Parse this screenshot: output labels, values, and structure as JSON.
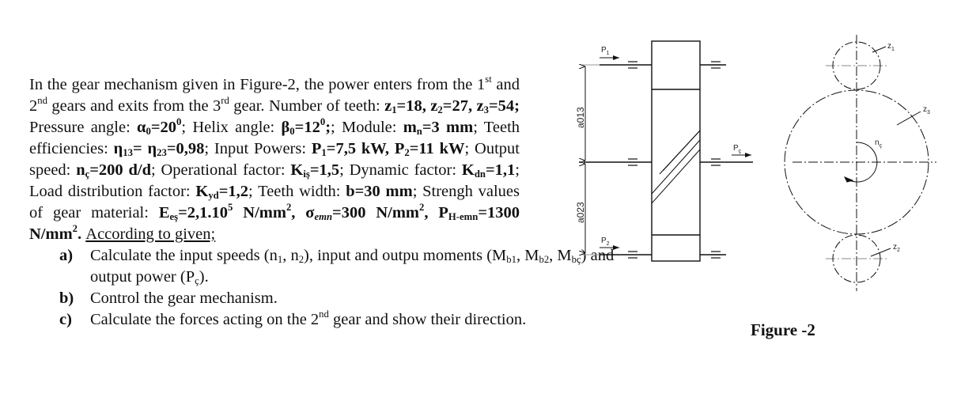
{
  "problem": {
    "intro_1": "In the gear mechanism given in Figure-2, the power enters from the 1",
    "sup_st": "st",
    "intro_2": " and 2",
    "sup_nd": "nd",
    "intro_3": " gears and exits from the 3",
    "sup_rd": "rd",
    "intro_4": " gear. Number of teeth: ",
    "teeth": [
      {
        "sym": "z",
        "sub": "1",
        "val": "=18, "
      },
      {
        "sym": "z",
        "sub": "2",
        "val": "=27, "
      },
      {
        "sym": "z",
        "sub": "3",
        "val": "=54;"
      }
    ],
    "pressure_label": " Pressure angle: ",
    "pressure_sym": "α",
    "pressure_sub": "0",
    "pressure_val": "=20",
    "pressure_unit_sup": "0",
    "helix_label": "; Helix angle: ",
    "helix_sym": "β",
    "helix_sub": "0",
    "helix_val": "=12",
    "helix_unit_sup": "0",
    "module_label": "; Module: ",
    "module_sym": "m",
    "module_sub": "n",
    "module_val": "=3 mm",
    "eff_label": "; Teeth efficiencies: ",
    "eff_sym1": "η",
    "eff_sub1": "13",
    "eff_mid": "= ",
    "eff_sym2": "η",
    "eff_sub2": "23",
    "eff_val": "=0,98",
    "power_label": "; Input Powers: ",
    "p1_sym": "P",
    "p1_sub": "1",
    "p1_val": "=7,5 kW, ",
    "p2_sym": "P",
    "p2_sub": "2",
    "p2_val": "=11 kW",
    "speed_label": "; Output speed: ",
    "speed_sym": "n",
    "speed_sub": "ç",
    "speed_val": "=200 d/d",
    "op_label": "; Operational factor: ",
    "op_sym": "K",
    "op_sub": "iş",
    "op_val": "=1,5",
    "dyn_label": "; Dynamic factor: ",
    "dyn_sym": "K",
    "dyn_sub": "dn",
    "dyn_val": "=1,1",
    "load_label": "; Load distribution factor: ",
    "load_sym": "K",
    "load_sub": "yd",
    "load_val": "=1,2",
    "width_label": "; Teeth width: ",
    "width_val": "b=30 mm",
    "strength_label": "; Strengh values of gear material: ",
    "e_sym": "E",
    "e_sub": "eş",
    "e_val": "=2,1.10",
    "e_exp": "5",
    "e_unit": " N/mm",
    "e_unit_sup": "2",
    "sigma_sym": "σ",
    "sigma_sub": "emn",
    "sigma_val": "=300 N/mm",
    "sigma_unit_sup": "2",
    "ph_sym": "P",
    "ph_sub": "H-emn",
    "ph_val": "=1300 N/mm",
    "ph_unit_sup": "2",
    "according": "According to given;",
    "questions": [
      {
        "mark": "a)",
        "text_1": "Calculate the input speeds (n",
        "s1": "1",
        "text_2": ", n",
        "s2": "2",
        "text_3": "), input and outpu moments (M",
        "s3": "b1",
        "text_4": ", M",
        "s4": "b2",
        "text_5": ", M",
        "s5": "bç",
        "text_6": ") and output power (P",
        "s6": "ç",
        "text_7": ")."
      },
      {
        "mark": "b)",
        "text": "Control the gear mechanism."
      },
      {
        "mark": "c)",
        "text_1": "Calculate the forces acting on the 2",
        "sup": "nd",
        "text_2": " gear and show their direction."
      }
    ]
  },
  "figure": {
    "caption": "Figure -2",
    "labels": {
      "p1": "P",
      "p1_sub": "1",
      "p2": "P",
      "p2_sub": "2",
      "pc": "P",
      "pc_sub": "ç",
      "a013": "a013",
      "a023": "a023",
      "z1": "z",
      "z1_sub": "1",
      "z2": "z",
      "z2_sub": "2",
      "z3": "z",
      "z3_sub": "3",
      "nc": "n",
      "nc_sub": "ç"
    }
  }
}
